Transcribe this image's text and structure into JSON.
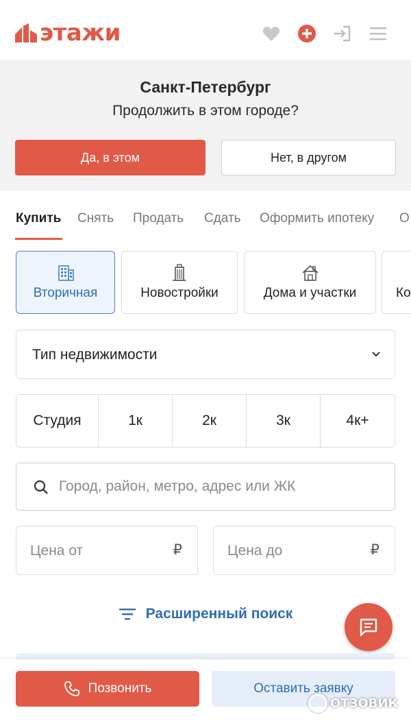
{
  "header": {
    "logo_text": "этажи",
    "icons": [
      "heart-icon",
      "add-circle-icon",
      "login-icon",
      "menu-icon"
    ],
    "brand_color": "#e05a47"
  },
  "city_prompt": {
    "city": "Санкт-Петербург",
    "question": "Продолжить в этом городе?",
    "yes_label": "Да, в этом",
    "no_label": "Нет, в другом"
  },
  "tabs": [
    {
      "label": "Купить",
      "active": true
    },
    {
      "label": "Снять",
      "active": false
    },
    {
      "label": "Продать",
      "active": false
    },
    {
      "label": "Сдать",
      "active": false
    },
    {
      "label": "Оформить ипотеку",
      "active": false
    },
    {
      "label": "О",
      "active": false
    }
  ],
  "categories": [
    {
      "label": "Вторичная",
      "icon": "building-icon",
      "active": true
    },
    {
      "label": "Новостройки",
      "icon": "skyscraper-icon",
      "active": false
    },
    {
      "label": "Дома и участки",
      "icon": "house-icon",
      "active": false
    },
    {
      "label": "Ко",
      "icon": "",
      "active": false
    }
  ],
  "filters": {
    "property_type_label": "Тип недвижимости",
    "rooms": [
      "Студия",
      "1к",
      "2к",
      "3к",
      "4к+"
    ],
    "search_placeholder": "Город, район, метро, адрес или ЖК",
    "price_from_placeholder": "Цена от",
    "price_to_placeholder": "Цена до",
    "currency": "₽",
    "advanced_search_label": "Расширенный поиск"
  },
  "bottom_bar": {
    "call_label": "Позвонить",
    "request_label": "Оставить заявку"
  },
  "watermark": "ОТЗОВИК",
  "colors": {
    "accent": "#e05a47",
    "link_blue": "#2f6db5",
    "active_bg": "#eef4fb"
  }
}
